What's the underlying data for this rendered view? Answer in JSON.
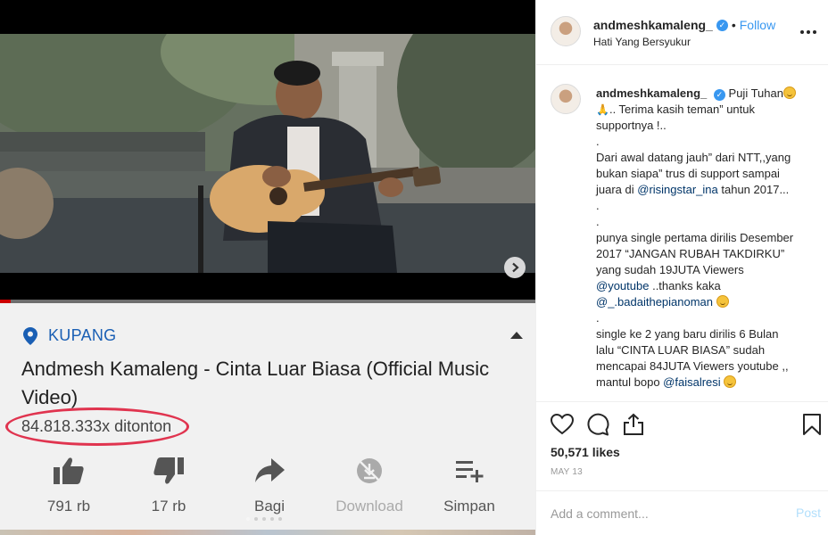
{
  "video": {
    "progress_fraction": 0.02,
    "location": "KUPANG",
    "title": "Andmesh Kamaleng - Cinta Luar Biasa (Official Music Video)",
    "views": "84.818.333x ditonton",
    "actions": [
      {
        "label": "791 rb",
        "icon": "thumbs-up-icon",
        "disabled": false
      },
      {
        "label": "17 rb",
        "icon": "thumbs-down-icon",
        "disabled": false
      },
      {
        "label": "Bagi",
        "icon": "share-icon",
        "disabled": false
      },
      {
        "label": "Download",
        "icon": "download-disabled-icon",
        "disabled": true
      },
      {
        "label": "Simpan",
        "icon": "playlist-add-icon",
        "disabled": false
      }
    ]
  },
  "post": {
    "username": "andmeshkamaleng_",
    "follow_label": "Follow",
    "separator": "•",
    "song": "Hati Yang Bersyukur",
    "caption_lines": [
      "Puji Tuhan",
      ".. Terima kasih teman” untuk",
      "supportnya !..",
      ".",
      "Dari awal datang jauh” dari NTT,,yang",
      "bukan siapa” trus di support sampai",
      "juara di @risingstar_ina tahun 2017...",
      ".",
      ".",
      "punya single pertama dirilis Desember",
      "2017 “JANGAN RUBAH TAKDIRKU”",
      "yang sudah 19JUTA Viewers",
      "@youtube ..thanks kaka",
      "@_.badaithepianoman",
      ".",
      "single ke 2 yang baru dirilis 6 Bulan",
      "lalu “CINTA LUAR BIASA” sudah",
      "mencapai 84JUTA Viewers youtube ,,",
      "mantul bopo @faisalresi"
    ],
    "mentions": {
      "risingstar": "@risingstar_ina",
      "youtube": "@youtube",
      "badai": "@_.badaithepianoman",
      "faisal": "@faisalresi"
    },
    "likes": "50,571 likes",
    "date": "MAY 13",
    "comment_placeholder": "Add a comment...",
    "post_label": "Post"
  },
  "colors": {
    "youtube_red": "#cc0000",
    "location_blue": "#1a5fb4",
    "oval_red": "#e0344f",
    "instagram_blue": "#3897f0",
    "mention_blue": "#003569"
  }
}
